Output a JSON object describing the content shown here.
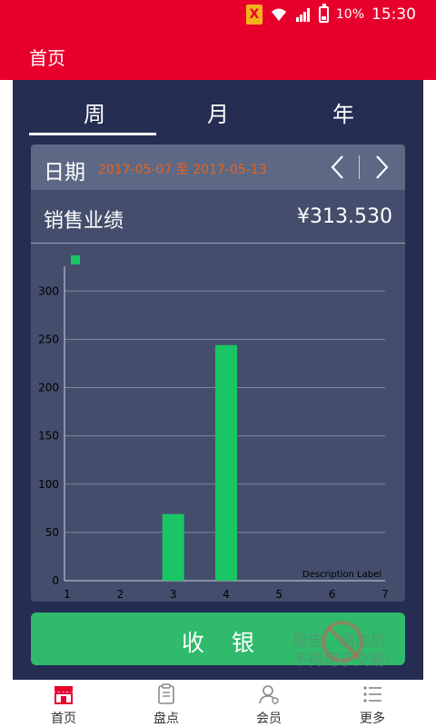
{
  "status_bar": {
    "battery": "10%",
    "time": "15:30",
    "sim_icon": "x-warning-icon"
  },
  "app_bar": {
    "title": "首页"
  },
  "tabs": [
    {
      "label": "周",
      "selected": true
    },
    {
      "label": "月",
      "selected": false
    },
    {
      "label": "年",
      "selected": false
    }
  ],
  "date_row": {
    "label": "日期",
    "range": "2017-05-07 至 2017-05-13"
  },
  "sales": {
    "label": "销售业绩",
    "value": "¥313.530"
  },
  "chart_data": {
    "type": "bar",
    "categories": [
      "1",
      "2",
      "3",
      "4",
      "5",
      "6",
      "7"
    ],
    "values": [
      0,
      0,
      69,
      244,
      0,
      0,
      0
    ],
    "ylim": [
      0,
      320
    ],
    "yticks": [
      0,
      50,
      100,
      150,
      200,
      250,
      300
    ],
    "grid": true,
    "legend_position": "top-left",
    "bar_color": "#19c663",
    "description_label": "Description Label"
  },
  "checkout": {
    "label": "收银"
  },
  "watermark": {
    "line1": "警告：调试机",
    "line2": "不得用于交易!"
  },
  "bottom_nav": [
    {
      "label": "首页",
      "icon": "shop-icon",
      "active": true
    },
    {
      "label": "盘点",
      "icon": "clipboard-icon",
      "active": false
    },
    {
      "label": "会员",
      "icon": "member-icon",
      "active": false
    },
    {
      "label": "更多",
      "icon": "list-icon",
      "active": false
    }
  ],
  "colors": {
    "primary": "#e8002d",
    "background": "#252d52",
    "card": "#444e6c",
    "accent": "#2fbb6b",
    "date_text": "#e8641c"
  }
}
